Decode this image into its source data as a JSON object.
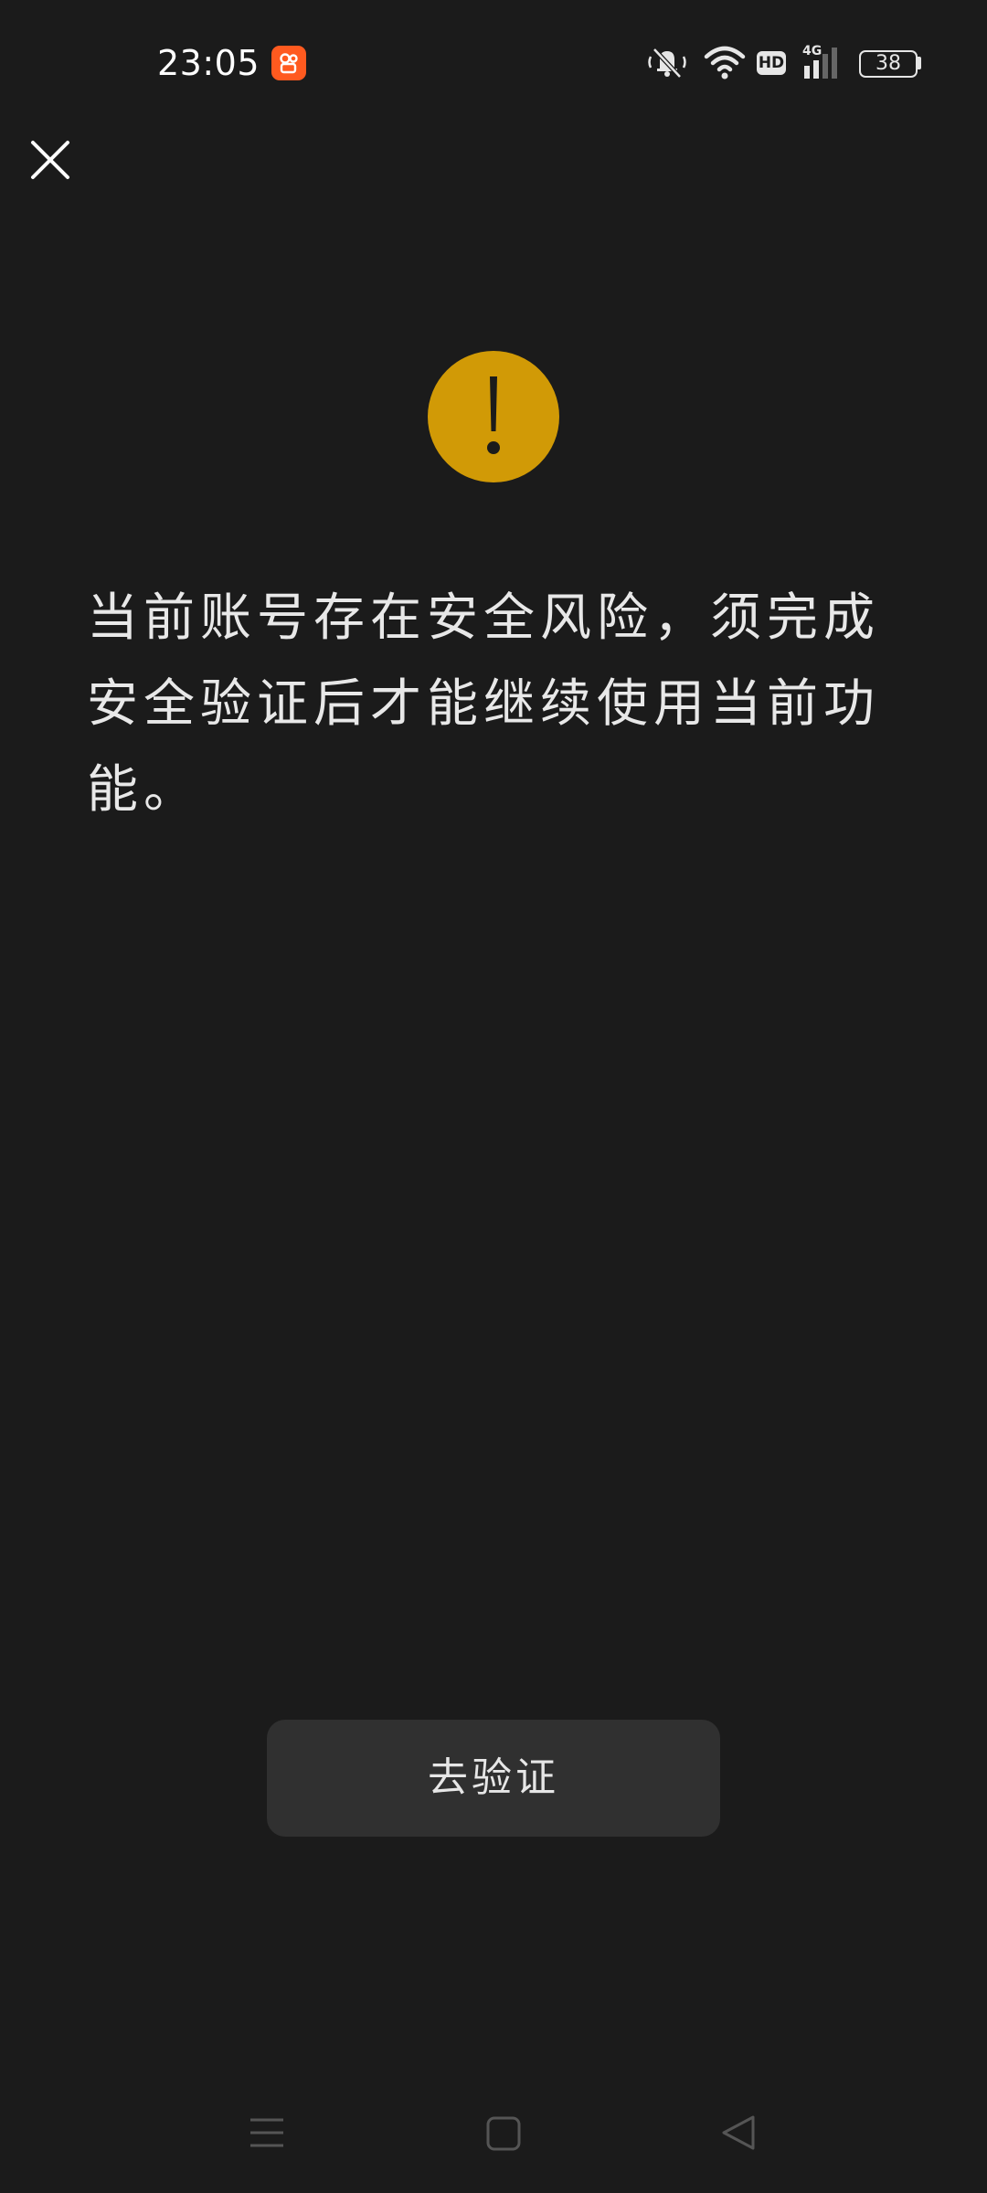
{
  "status_bar": {
    "time": "23:05",
    "network_label": "4G",
    "hd_label": "HD",
    "battery_level": "38"
  },
  "dialog": {
    "message": "当前账号存在安全风险，须完成安全验证后才能继续使用当前功能。",
    "button_label": "去验证"
  },
  "colors": {
    "background": "#1b1b1b",
    "warning": "#d19a06",
    "button": "#303030",
    "app_badge": "#ff5a1f"
  },
  "icons": {
    "close": "close-icon",
    "warning": "exclamation-icon",
    "nav_menu": "menu-icon",
    "nav_home": "home-icon",
    "nav_back": "back-icon"
  }
}
